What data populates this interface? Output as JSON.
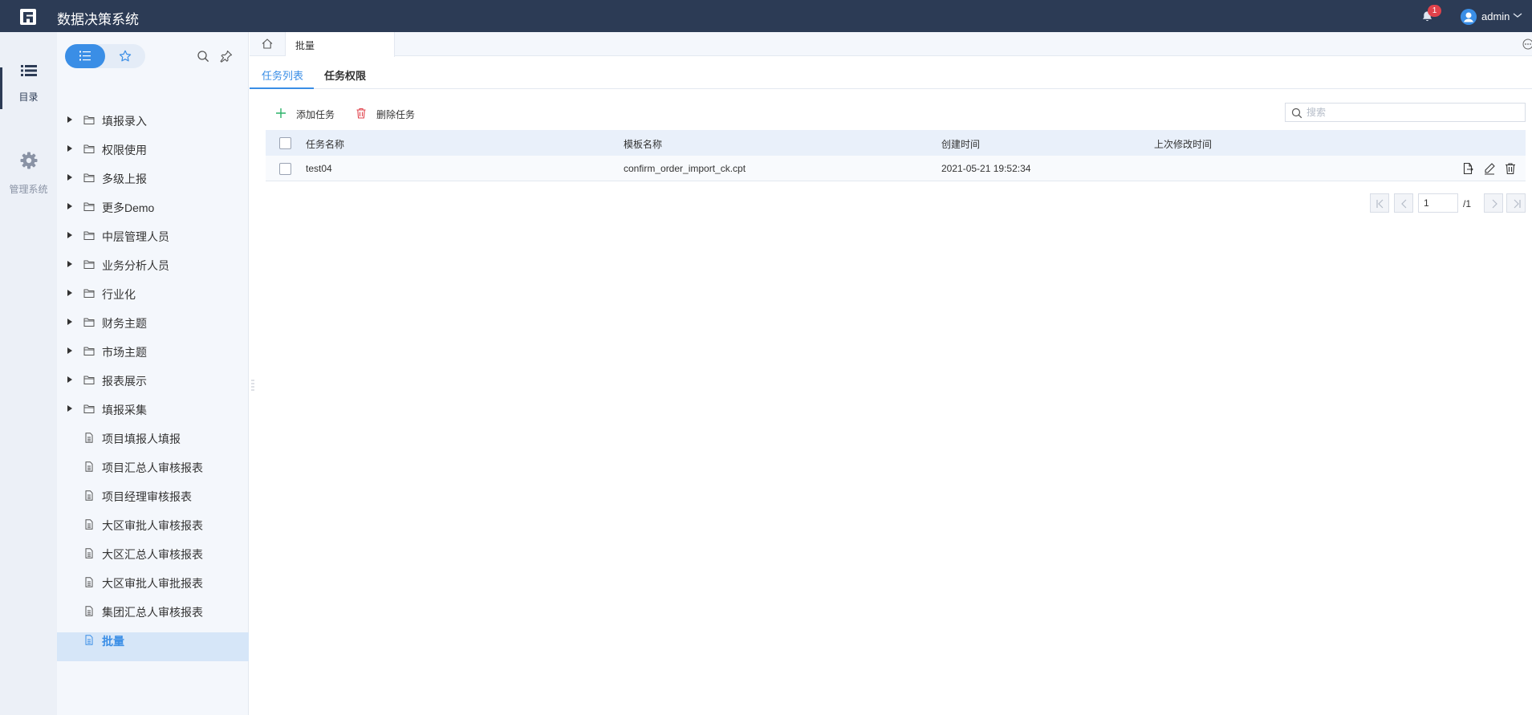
{
  "app": {
    "title": "数据决策系统",
    "notification_count": "1",
    "username": "admin"
  },
  "rail": {
    "items": [
      {
        "label": "目录"
      },
      {
        "label": "管理系统"
      }
    ]
  },
  "tree": {
    "nodes": [
      {
        "label": "填报录入",
        "type": "folder"
      },
      {
        "label": "权限使用",
        "type": "folder"
      },
      {
        "label": "多级上报",
        "type": "folder"
      },
      {
        "label": "更多Demo",
        "type": "folder"
      },
      {
        "label": "中层管理人员",
        "type": "folder"
      },
      {
        "label": "业务分析人员",
        "type": "folder"
      },
      {
        "label": "行业化",
        "type": "folder"
      },
      {
        "label": "财务主题",
        "type": "folder"
      },
      {
        "label": "市场主题",
        "type": "folder"
      },
      {
        "label": "报表展示",
        "type": "folder"
      },
      {
        "label": "填报采集",
        "type": "folder"
      },
      {
        "label": "项目填报人填报",
        "type": "file"
      },
      {
        "label": "项目汇总人审核报表",
        "type": "file"
      },
      {
        "label": "项目经理审核报表",
        "type": "file"
      },
      {
        "label": "大区审批人审核报表",
        "type": "file"
      },
      {
        "label": "大区汇总人审核报表",
        "type": "file"
      },
      {
        "label": "大区审批人审批报表",
        "type": "file"
      },
      {
        "label": "集团汇总人审核报表",
        "type": "file"
      },
      {
        "label": "批量",
        "type": "file",
        "selected": true
      }
    ]
  },
  "tabs": {
    "open": [
      {
        "label": "批量"
      }
    ]
  },
  "subtabs": [
    {
      "label": "任务列表",
      "active": true
    },
    {
      "label": "任务权限",
      "active": false
    }
  ],
  "toolbar": {
    "add_label": "添加任务",
    "delete_label": "删除任务",
    "search_placeholder": "搜索"
  },
  "table": {
    "columns": [
      "任务名称",
      "模板名称",
      "创建时间",
      "上次修改时间"
    ],
    "rows": [
      {
        "task_name": "test04",
        "template": "confirm_order_import_ck.cpt",
        "created": "2021-05-21 19:52:34",
        "modified": ""
      }
    ]
  },
  "pager": {
    "current_page": "1",
    "total_label": "/1"
  },
  "colors": {
    "topbar": "#2c3b55",
    "accent": "#3a8ee6",
    "badge": "#e0424b",
    "add_icon": "#2db36a",
    "delete_icon": "#e0424b"
  },
  "icons": {
    "logo": "fr-logo",
    "bell": "bell-icon",
    "list": "list-icon",
    "gear": "gear-icon",
    "star": "star-icon"
  }
}
